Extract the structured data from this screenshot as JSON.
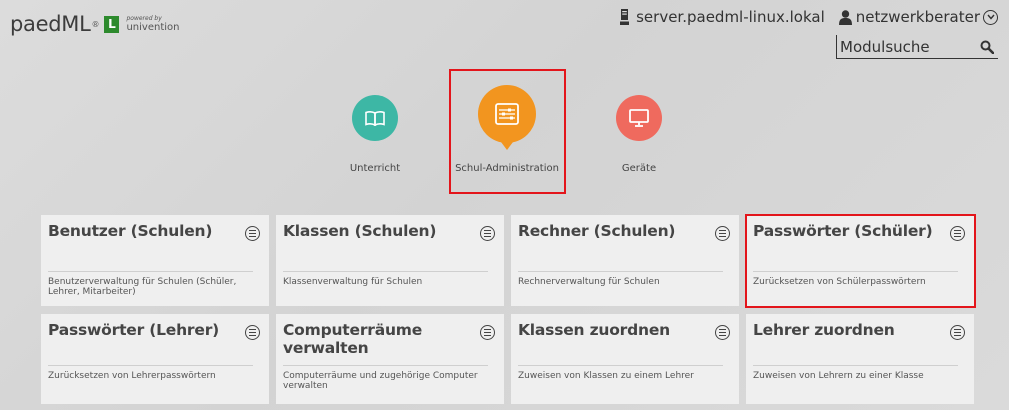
{
  "header": {
    "logo": {
      "text": "paedML",
      "badge": "L",
      "powered_by": "powered by",
      "vendor": "univention"
    },
    "server": "server.paedml-linux.lokal",
    "user": "netzwerkberater",
    "search": {
      "placeholder": "Modulsuche"
    }
  },
  "categories": [
    {
      "label": "Unterricht",
      "icon": "book-icon",
      "color": "#3db7a5"
    },
    {
      "label": "Schul-Administration",
      "icon": "admin-icon",
      "color": "#f2951f",
      "selected": true
    },
    {
      "label": "Geräte",
      "icon": "monitor-icon",
      "color": "#ef6a5e"
    }
  ],
  "modules": [
    {
      "title": "Benutzer (Schulen)",
      "description": "Benutzerverwaltung für Schulen (Schüler, Lehrer, Mitarbeiter)"
    },
    {
      "title": "Klassen (Schulen)",
      "description": "Klassenverwaltung für Schulen"
    },
    {
      "title": "Rechner (Schulen)",
      "description": "Rechnerverwaltung für Schulen"
    },
    {
      "title": "Passwörter (Schüler)",
      "description": "Zurücksetzen von Schülerpasswörtern"
    },
    {
      "title": "Passwörter (Lehrer)",
      "description": "Zurücksetzen von Lehrerpasswörtern"
    },
    {
      "title": "Computerräume verwalten",
      "description": "Computerräume und zugehörige Computer verwalten"
    },
    {
      "title": "Klassen zuordnen",
      "description": "Zuweisen von Klassen zu einem Lehrer"
    },
    {
      "title": "Lehrer zuordnen",
      "description": "Zuweisen von Lehrern zu einer Klasse"
    }
  ],
  "colors": {
    "highlight": "#e3151b",
    "tile_bg": "#efefef"
  }
}
